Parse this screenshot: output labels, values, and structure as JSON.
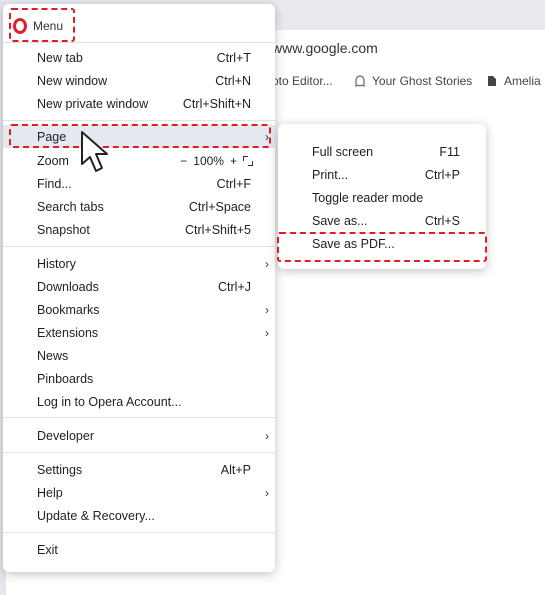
{
  "browser": {
    "url": "www.google.com",
    "bookmarks": [
      {
        "label": "oto Editor...",
        "icon": "globe-icon"
      },
      {
        "label": "Your Ghost Stories",
        "icon": "ghost-icon"
      },
      {
        "label": "Amelia",
        "icon": "document-icon"
      }
    ]
  },
  "menu": {
    "title": "Menu",
    "items": [
      {
        "label": "New tab",
        "shortcut": "Ctrl+T"
      },
      {
        "label": "New window",
        "shortcut": "Ctrl+N"
      },
      {
        "label": "New private window",
        "shortcut": "Ctrl+Shift+N"
      },
      {
        "label": "Page",
        "shortcut": "",
        "submenu": true
      },
      {
        "label": "Zoom",
        "shortcut": ""
      },
      {
        "label": "Find...",
        "shortcut": "Ctrl+F"
      },
      {
        "label": "Search tabs",
        "shortcut": "Ctrl+Space"
      },
      {
        "label": "Snapshot",
        "shortcut": "Ctrl+Shift+5"
      },
      {
        "label": "History",
        "shortcut": "",
        "submenu": true
      },
      {
        "label": "Downloads",
        "shortcut": "Ctrl+J"
      },
      {
        "label": "Bookmarks",
        "shortcut": "",
        "submenu": true
      },
      {
        "label": "Extensions",
        "shortcut": "",
        "submenu": true
      },
      {
        "label": "News",
        "shortcut": ""
      },
      {
        "label": "Pinboards",
        "shortcut": ""
      },
      {
        "label": "Log in to Opera Account...",
        "shortcut": ""
      },
      {
        "label": "Developer",
        "shortcut": "",
        "submenu": true
      },
      {
        "label": "Settings",
        "shortcut": "Alt+P"
      },
      {
        "label": "Help",
        "shortcut": "",
        "submenu": true
      },
      {
        "label": "Update & Recovery...",
        "shortcut": ""
      },
      {
        "label": "Exit",
        "shortcut": ""
      }
    ],
    "zoom": {
      "minus": "−",
      "value": "100%",
      "plus": "+"
    },
    "chevron": "›"
  },
  "submenu": {
    "items": [
      {
        "label": "Full screen",
        "shortcut": "F11"
      },
      {
        "label": "Print...",
        "shortcut": "Ctrl+P"
      },
      {
        "label": "Toggle reader mode",
        "shortcut": ""
      },
      {
        "label": "Save as...",
        "shortcut": "Ctrl+S"
      },
      {
        "label": "Save as PDF...",
        "shortcut": ""
      }
    ]
  },
  "colors": {
    "annotation": "#e31b23",
    "opera_red": "#e0202b",
    "highlight": "#e4e8ef"
  }
}
